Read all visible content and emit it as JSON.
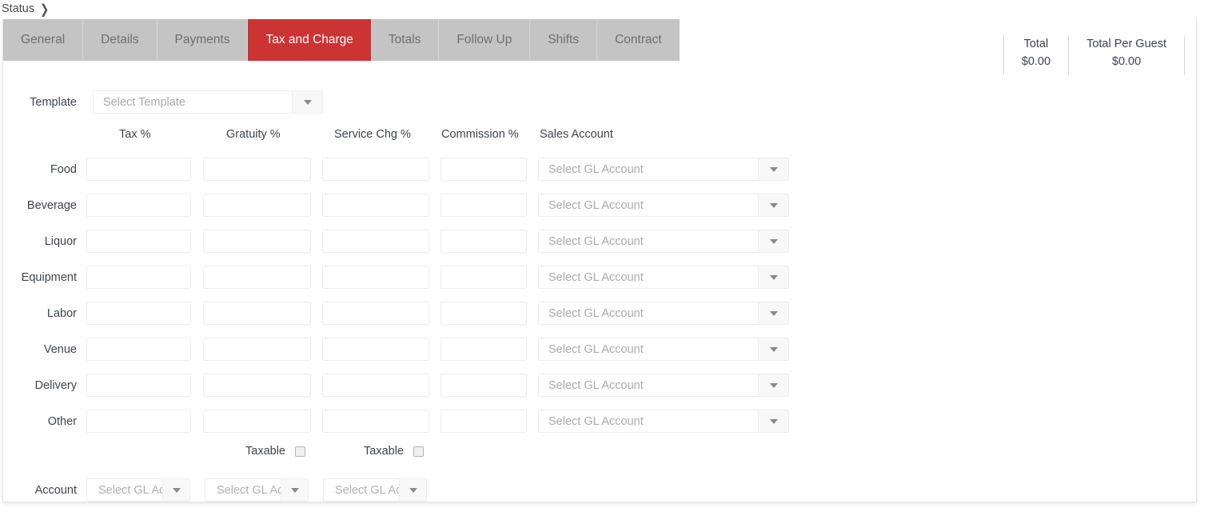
{
  "breadcrumb": {
    "items": [
      "Status"
    ],
    "separator_icon": "chevron-right-icon"
  },
  "tabs": [
    {
      "label": "General",
      "active": false
    },
    {
      "label": "Details",
      "active": false
    },
    {
      "label": "Payments",
      "active": false
    },
    {
      "label": "Tax and Charge",
      "active": true
    },
    {
      "label": "Totals",
      "active": false
    },
    {
      "label": "Follow Up",
      "active": false
    },
    {
      "label": "Shifts",
      "active": false
    },
    {
      "label": "Contract",
      "active": false
    }
  ],
  "totals": [
    {
      "label": "Total",
      "value": "$0.00"
    },
    {
      "label": "Total Per Guest",
      "value": "$0.00"
    }
  ],
  "template": {
    "label": "Template",
    "placeholder": "Select Template",
    "value": "",
    "dropdown_icon": "chevron-down-icon"
  },
  "columns": [
    {
      "label": "Tax %"
    },
    {
      "label": "Gratuity %"
    },
    {
      "label": "Service Chg %"
    },
    {
      "label": "Commission %"
    },
    {
      "label": "Sales Account"
    }
  ],
  "rows": [
    {
      "label": "Food",
      "tax": "",
      "gratuity": "",
      "service": "",
      "commission": "",
      "account_placeholder": "Select GL Account",
      "account_value": ""
    },
    {
      "label": "Beverage",
      "tax": "",
      "gratuity": "",
      "service": "",
      "commission": "",
      "account_placeholder": "Select GL Account",
      "account_value": ""
    },
    {
      "label": "Liquor",
      "tax": "",
      "gratuity": "",
      "service": "",
      "commission": "",
      "account_placeholder": "Select GL Account",
      "account_value": ""
    },
    {
      "label": "Equipment",
      "tax": "",
      "gratuity": "",
      "service": "",
      "commission": "",
      "account_placeholder": "Select GL Account",
      "account_value": ""
    },
    {
      "label": "Labor",
      "tax": "",
      "gratuity": "",
      "service": "",
      "commission": "",
      "account_placeholder": "Select GL Account",
      "account_value": ""
    },
    {
      "label": "Venue",
      "tax": "",
      "gratuity": "",
      "service": "",
      "commission": "",
      "account_placeholder": "Select GL Account",
      "account_value": ""
    },
    {
      "label": "Delivery",
      "tax": "",
      "gratuity": "",
      "service": "",
      "commission": "",
      "account_placeholder": "Select GL Account",
      "account_value": ""
    },
    {
      "label": "Other",
      "tax": "",
      "gratuity": "",
      "service": "",
      "commission": "",
      "account_placeholder": "Select GL Account",
      "account_value": ""
    }
  ],
  "taxable": [
    {
      "label": "Taxable",
      "checked": false
    },
    {
      "label": "Taxable",
      "checked": false
    }
  ],
  "account": {
    "label": "Account",
    "fields": [
      {
        "placeholder": "Select GL Account",
        "value": ""
      },
      {
        "placeholder": "Select GL Account",
        "value": ""
      },
      {
        "placeholder": "Select GL Account",
        "value": ""
      }
    ]
  },
  "colors": {
    "active_tab": "#cc3333",
    "tab_bg": "#c4c4c4",
    "tab_text": "#6f6f6f",
    "field_border": "#eceded",
    "text": "#3d4450"
  }
}
